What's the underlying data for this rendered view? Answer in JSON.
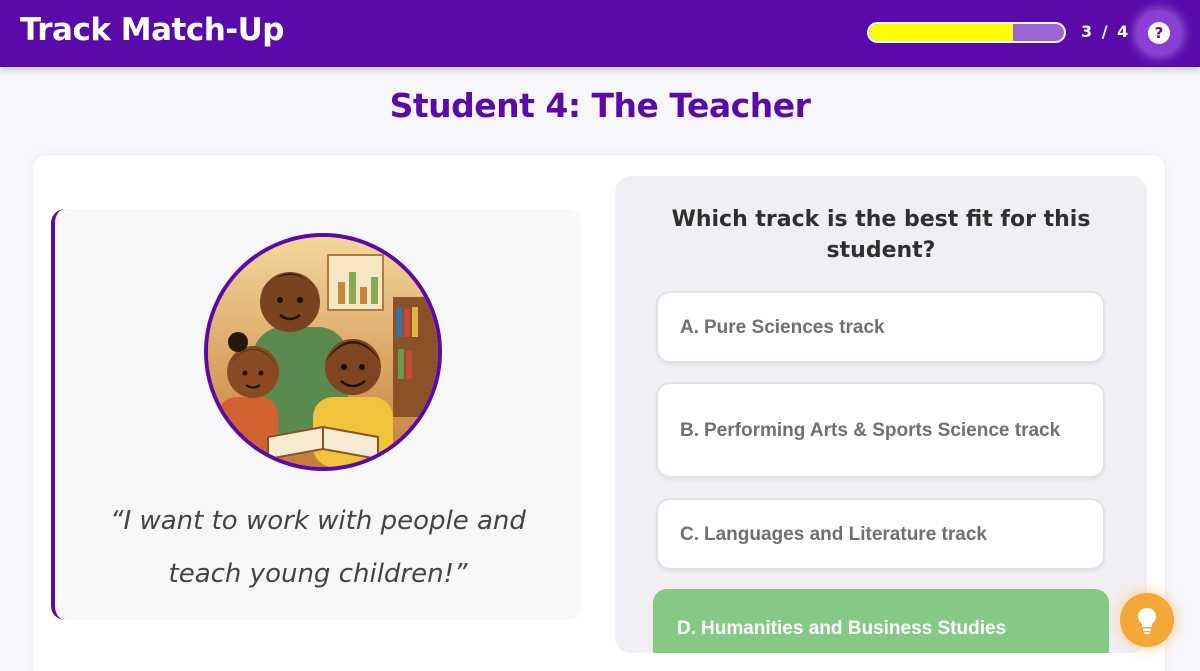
{
  "header": {
    "title": "Track Match-Up",
    "progress_text": "3 / 4",
    "progress_fraction": 0.74,
    "help_icon": "question-mark-icon"
  },
  "student": {
    "title": "Student 4: The Teacher",
    "quote": "“I want to work with people and teach young children!”",
    "image_icon": "teacher-with-children-illustration"
  },
  "question": {
    "text": "Which track is the best fit for this student?",
    "options": [
      {
        "letter": "A.",
        "label": "Pure Sciences track"
      },
      {
        "letter": "B.",
        "label": "Performing Arts & Sports Science track"
      },
      {
        "letter": "C.",
        "label": "Languages and Literature track"
      },
      {
        "letter": "D.",
        "label": "Humanities and Business Studies"
      }
    ],
    "selected_index": 3
  },
  "hint": {
    "icon": "lightbulb-icon"
  },
  "colors": {
    "brand": "#5a0aa9",
    "progress": "#ffff00",
    "selected": "#86c985",
    "hint": "#f5a83a"
  }
}
